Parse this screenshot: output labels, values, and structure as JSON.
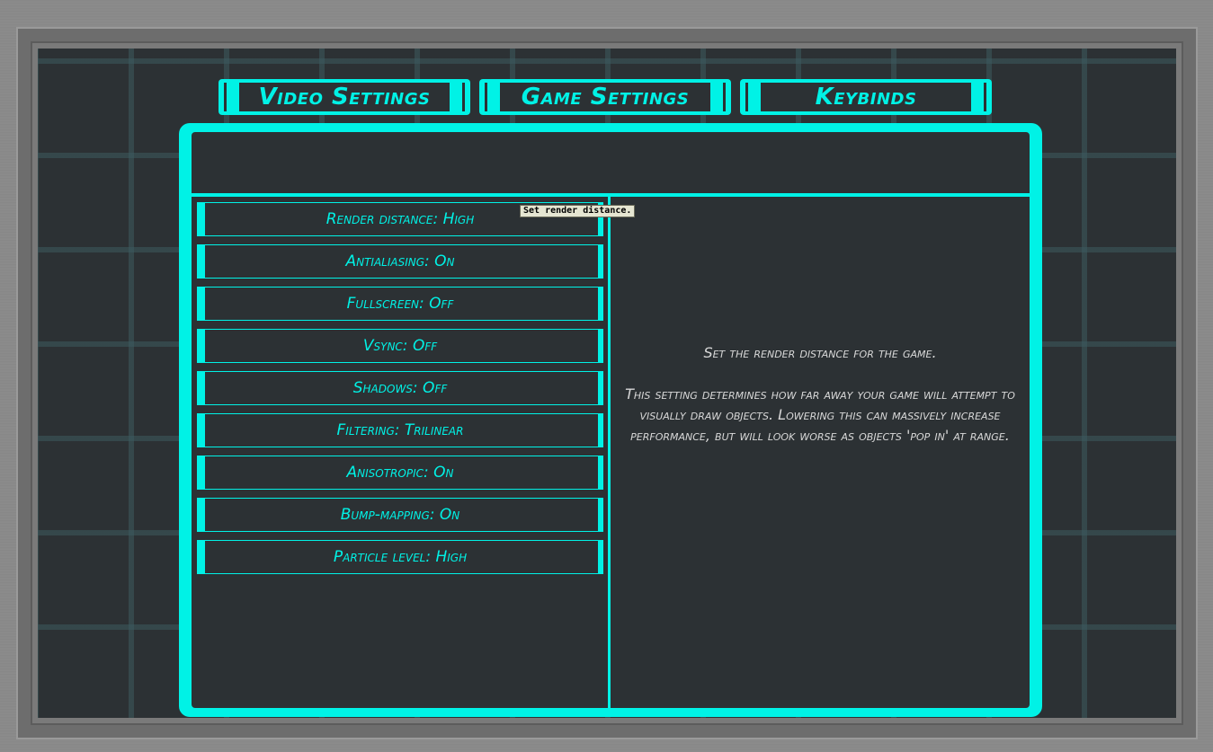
{
  "tabs": [
    {
      "label": "Video Settings"
    },
    {
      "label": "Game Settings"
    },
    {
      "label": "Keybinds"
    }
  ],
  "options": [
    {
      "label": "Render distance: High"
    },
    {
      "label": "Antialiasing: On"
    },
    {
      "label": "Fullscreen: Off"
    },
    {
      "label": "Vsync: Off"
    },
    {
      "label": "Shadows: Off"
    },
    {
      "label": "Filtering: Trilinear"
    },
    {
      "label": "Anisotropic: On"
    },
    {
      "label": "Bump-mapping: On"
    },
    {
      "label": "Particle level: High"
    }
  ],
  "description": {
    "summary": "Set the render distance for the game.",
    "detail": "This setting determines how far away your game will attempt to visually draw objects. Lowering this can massively increase performance, but will look worse as objects 'pop in' at range."
  },
  "tooltip": "Set render distance.",
  "colors": {
    "accent": "#00f2e6",
    "background": "#2c3134",
    "frame": "#7a7a7a"
  }
}
